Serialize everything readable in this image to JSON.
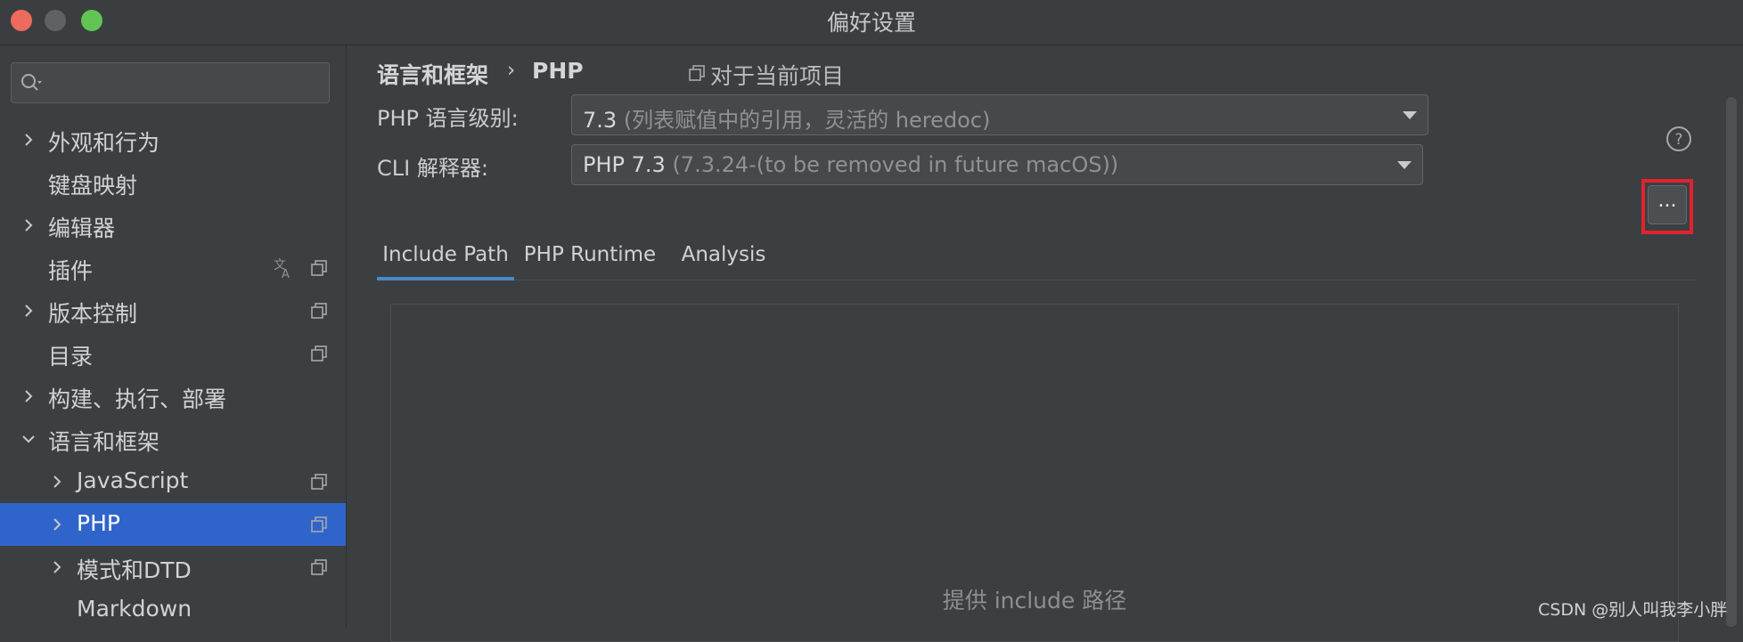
{
  "window": {
    "title": "偏好设置"
  },
  "sidebar": {
    "search": {
      "value": "",
      "placeholder": ""
    },
    "items": [
      {
        "label": "外观和行为",
        "expanded": false,
        "has_children": true,
        "level": 0
      },
      {
        "label": "键盘映射",
        "has_children": false,
        "level": 0
      },
      {
        "label": "编辑器",
        "expanded": false,
        "has_children": true,
        "level": 0
      },
      {
        "label": "插件",
        "has_children": false,
        "level": 0,
        "icons": [
          "translate-icon",
          "copy-icon"
        ]
      },
      {
        "label": "版本控制",
        "expanded": false,
        "has_children": true,
        "level": 0,
        "icons": [
          "copy-icon"
        ]
      },
      {
        "label": "目录",
        "has_children": false,
        "level": 0,
        "icons": [
          "copy-icon"
        ]
      },
      {
        "label": "构建、执行、部署",
        "expanded": false,
        "has_children": true,
        "level": 0
      },
      {
        "label": "语言和框架",
        "expanded": true,
        "has_children": true,
        "level": 0
      },
      {
        "label": "JavaScript",
        "expanded": false,
        "has_children": true,
        "level": 1,
        "icons": [
          "copy-icon"
        ]
      },
      {
        "label": "PHP",
        "expanded": false,
        "has_children": true,
        "level": 1,
        "selected": true,
        "icons": [
          "copy-icon"
        ]
      },
      {
        "label": "模式和DTD",
        "expanded": false,
        "has_children": true,
        "level": 1,
        "icons": [
          "copy-icon"
        ]
      },
      {
        "label": "Markdown",
        "has_children": false,
        "level": 1
      }
    ]
  },
  "main": {
    "breadcrumb": {
      "root": "语言和框架",
      "separator": "›",
      "leaf": "PHP"
    },
    "scope": {
      "label": "对于当前项目",
      "icon": "copy-icon"
    },
    "php_level": {
      "label": "PHP 语言级别:",
      "value": "7.3",
      "detail": "(列表赋值中的引用，灵活的 heredoc)"
    },
    "cli": {
      "label": "CLI 解释器:",
      "value": "PHP 7.3",
      "detail": "(7.3.24-(to be removed in future macOS))",
      "more_label": "..."
    },
    "tabs": [
      {
        "label": "Include Path",
        "active": true
      },
      {
        "label": "PHP Runtime",
        "active": false
      },
      {
        "label": "Analysis",
        "active": false
      }
    ],
    "include_path": {
      "hint": "提供 include 路径"
    }
  },
  "watermark": "CSDN @别人叫我李小胖",
  "colors": {
    "selection": "#2f65ca",
    "highlight_border": "#e0232c",
    "tab_underline": "#4a88c7",
    "background": "#3c3f41"
  }
}
